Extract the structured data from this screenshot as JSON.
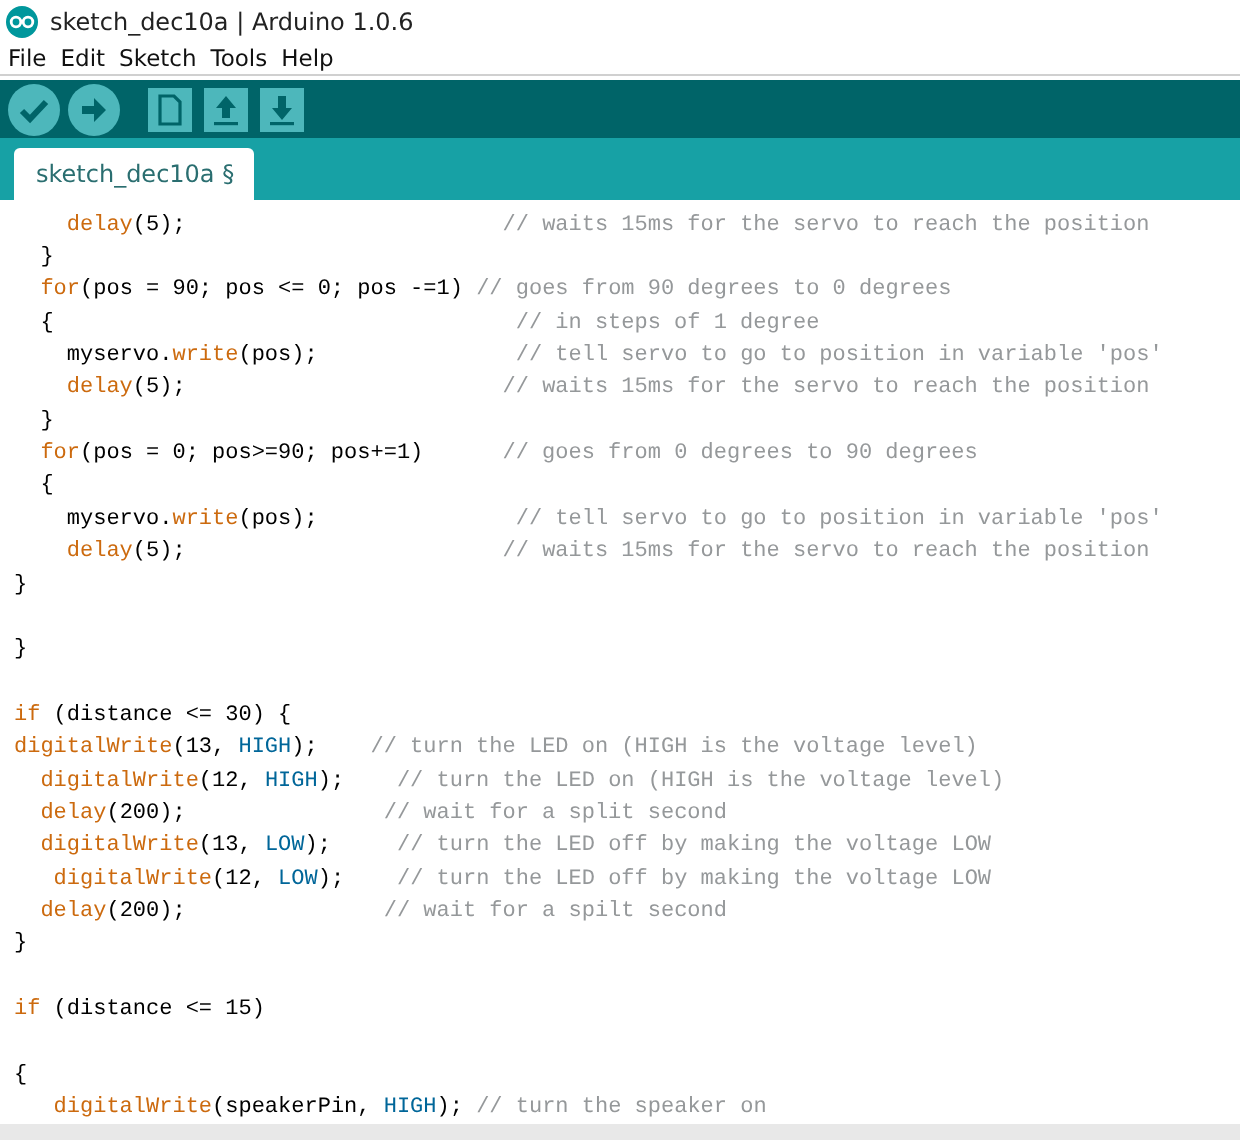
{
  "window": {
    "title": "sketch_dec10a | Arduino 1.0.6"
  },
  "menu": [
    "File",
    "Edit",
    "Sketch",
    "Tools",
    "Help"
  ],
  "toolbar": [
    {
      "kind": "verify"
    },
    {
      "kind": "upload"
    },
    {
      "kind": "new"
    },
    {
      "kind": "open"
    },
    {
      "kind": "save"
    }
  ],
  "tabs": [
    {
      "label": "sketch_dec10a §",
      "selected": true
    }
  ],
  "code": [
    {
      "kind": "code",
      "segments": [
        {
          "t": "    delay",
          "kind": "keyword"
        },
        {
          "t": "(5);                        "
        },
        {
          "t": "// waits 15ms for the servo to reach the position",
          "kind": "comment"
        }
      ]
    },
    {
      "kind": "code",
      "segments": [
        {
          "t": "  }"
        }
      ]
    },
    {
      "kind": "code",
      "segments": [
        {
          "t": "  for",
          "kind": "keyword"
        },
        {
          "t": "(pos = 90; pos <= 0; pos -=1) "
        },
        {
          "t": "// goes from 90 degrees to 0 degrees",
          "kind": "comment"
        }
      ]
    },
    {
      "kind": "code",
      "segments": [
        {
          "t": "  {                                   "
        },
        {
          "t": "// in steps of 1 degree",
          "kind": "comment"
        }
      ]
    },
    {
      "kind": "code",
      "segments": [
        {
          "t": "    myservo."
        },
        {
          "t": "write",
          "kind": "keyword"
        },
        {
          "t": "(pos);               "
        },
        {
          "t": "// tell servo to go to position in variable 'pos'",
          "kind": "comment"
        }
      ]
    },
    {
      "kind": "code",
      "segments": [
        {
          "t": "    delay",
          "kind": "keyword"
        },
        {
          "t": "(5);                        "
        },
        {
          "t": "// waits 15ms for the servo to reach the position",
          "kind": "comment"
        }
      ]
    },
    {
      "kind": "code",
      "segments": [
        {
          "t": "  }"
        }
      ]
    },
    {
      "kind": "code",
      "segments": [
        {
          "t": "  for",
          "kind": "keyword"
        },
        {
          "t": "(pos = 0; pos>=90; pos+=1)      "
        },
        {
          "t": "// goes from 0 degrees to 90 degrees",
          "kind": "comment"
        }
      ]
    },
    {
      "kind": "code",
      "segments": [
        {
          "t": "  {"
        }
      ]
    },
    {
      "kind": "code",
      "segments": [
        {
          "t": "    myservo."
        },
        {
          "t": "write",
          "kind": "keyword"
        },
        {
          "t": "(pos);               "
        },
        {
          "t": "// tell servo to go to position in variable 'pos'",
          "kind": "comment"
        }
      ]
    },
    {
      "kind": "code",
      "segments": [
        {
          "t": "    delay",
          "kind": "keyword"
        },
        {
          "t": "(5);                        "
        },
        {
          "t": "// waits 15ms for the servo to reach the position",
          "kind": "comment"
        }
      ]
    },
    {
      "kind": "code",
      "segments": [
        {
          "t": "}"
        }
      ]
    },
    {
      "kind": "blank"
    },
    {
      "kind": "code",
      "segments": [
        {
          "t": "}"
        }
      ]
    },
    {
      "kind": "blank"
    },
    {
      "kind": "code",
      "segments": [
        {
          "t": "if",
          "kind": "keyword"
        },
        {
          "t": " (distance <= 30) {"
        }
      ]
    },
    {
      "kind": "code",
      "segments": [
        {
          "t": "digitalWrite",
          "kind": "keyword"
        },
        {
          "t": "(13, "
        },
        {
          "t": "HIGH",
          "kind": "constant"
        },
        {
          "t": ");    "
        },
        {
          "t": "// turn the LED on (HIGH is the voltage level)",
          "kind": "comment"
        }
      ]
    },
    {
      "kind": "code",
      "segments": [
        {
          "t": "  digitalWrite",
          "kind": "keyword"
        },
        {
          "t": "(12, "
        },
        {
          "t": "HIGH",
          "kind": "constant"
        },
        {
          "t": ");    "
        },
        {
          "t": "// turn the LED on (HIGH is the voltage level)",
          "kind": "comment"
        }
      ]
    },
    {
      "kind": "code",
      "segments": [
        {
          "t": "  delay",
          "kind": "keyword"
        },
        {
          "t": "(200);               "
        },
        {
          "t": "// wait for a split second",
          "kind": "comment"
        }
      ]
    },
    {
      "kind": "code",
      "segments": [
        {
          "t": "  digitalWrite",
          "kind": "keyword"
        },
        {
          "t": "(13, "
        },
        {
          "t": "LOW",
          "kind": "constant"
        },
        {
          "t": ");     "
        },
        {
          "t": "// turn the LED off by making the voltage LOW",
          "kind": "comment"
        }
      ]
    },
    {
      "kind": "code",
      "segments": [
        {
          "t": "   digitalWrite",
          "kind": "keyword"
        },
        {
          "t": "(12, "
        },
        {
          "t": "LOW",
          "kind": "constant"
        },
        {
          "t": ");    "
        },
        {
          "t": "// turn the LED off by making the voltage LOW",
          "kind": "comment"
        }
      ]
    },
    {
      "kind": "code",
      "segments": [
        {
          "t": "  delay",
          "kind": "keyword"
        },
        {
          "t": "(200);               "
        },
        {
          "t": "// wait for a spilt second",
          "kind": "comment"
        }
      ]
    },
    {
      "kind": "code",
      "segments": [
        {
          "t": "}"
        }
      ]
    },
    {
      "kind": "blank"
    },
    {
      "kind": "code",
      "segments": [
        {
          "t": "if",
          "kind": "keyword"
        },
        {
          "t": " (distance <= 15)"
        }
      ]
    },
    {
      "kind": "blank"
    },
    {
      "kind": "code",
      "segments": [
        {
          "t": "{"
        }
      ]
    },
    {
      "kind": "code",
      "segments": [
        {
          "t": "   digitalWrite",
          "kind": "keyword"
        },
        {
          "t": "(speakerPin, "
        },
        {
          "t": "HIGH",
          "kind": "constant"
        },
        {
          "t": "); "
        },
        {
          "t": "// turn the speaker on",
          "kind": "comment"
        }
      ]
    }
  ]
}
